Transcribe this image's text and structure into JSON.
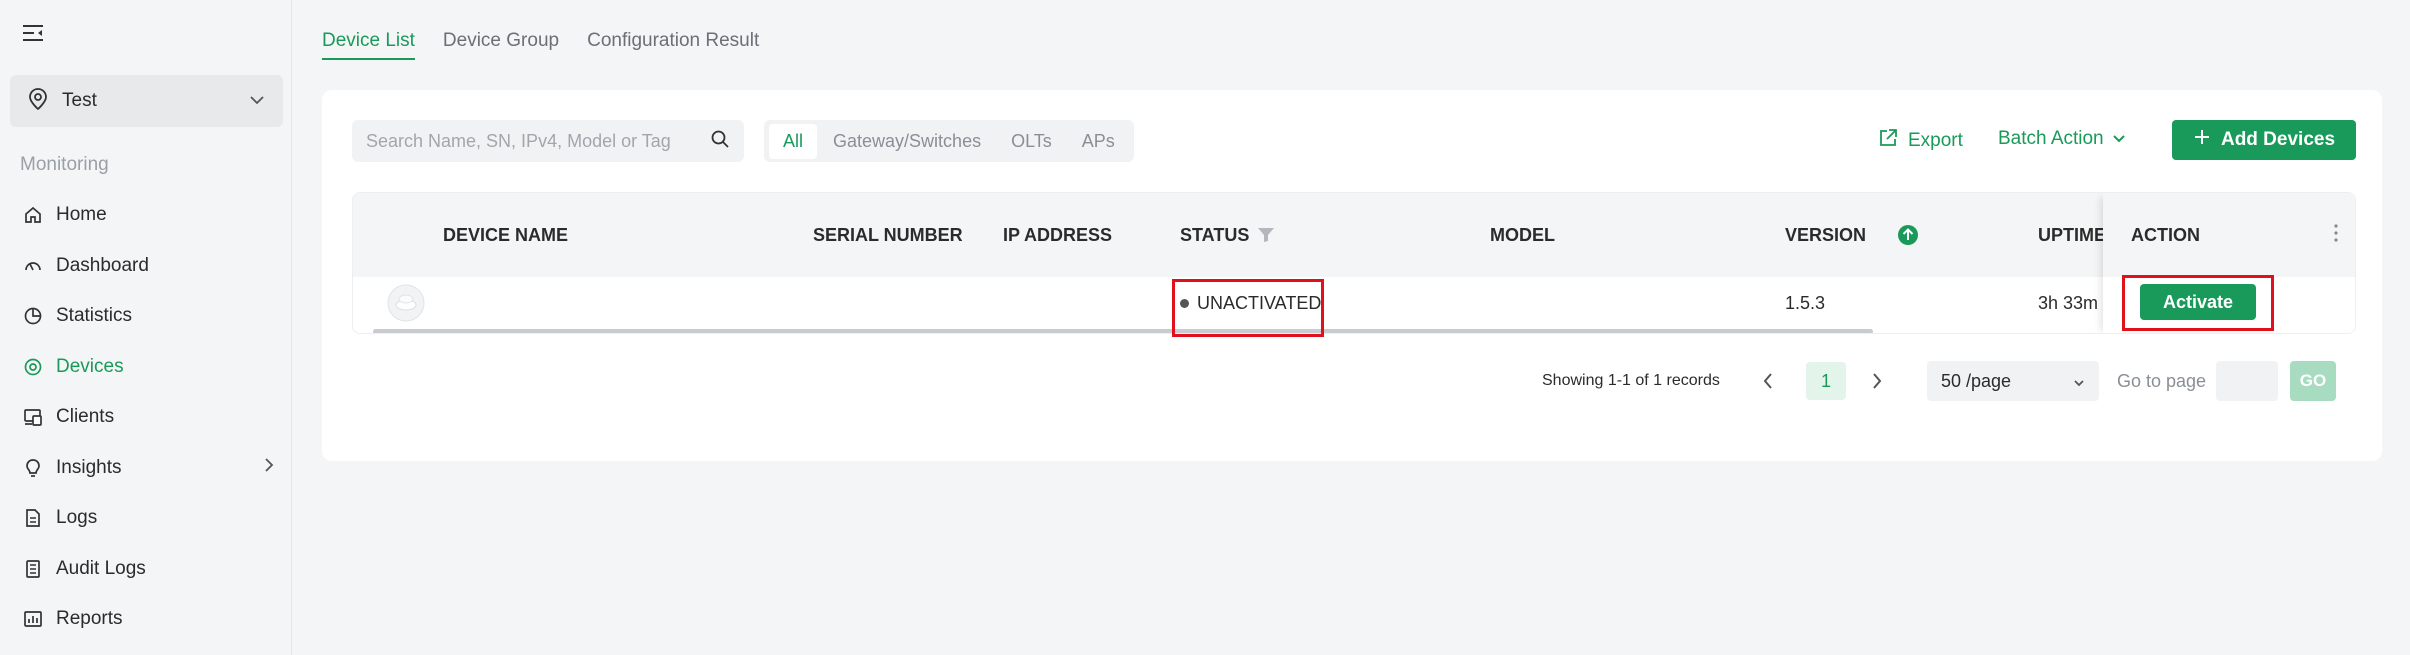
{
  "sidebar": {
    "site_name": "Test",
    "section_title": "Monitoring",
    "items": [
      {
        "label": "Home",
        "icon": "home-icon"
      },
      {
        "label": "Dashboard",
        "icon": "gauge-icon"
      },
      {
        "label": "Statistics",
        "icon": "pie-chart-icon"
      },
      {
        "label": "Devices",
        "icon": "target-icon",
        "active": true
      },
      {
        "label": "Clients",
        "icon": "clients-icon"
      },
      {
        "label": "Insights",
        "icon": "lightbulb-icon"
      },
      {
        "label": "Logs",
        "icon": "document-icon"
      },
      {
        "label": "Audit Logs",
        "icon": "list-document-icon"
      },
      {
        "label": "Reports",
        "icon": "report-chart-icon"
      }
    ]
  },
  "tabs": [
    "Device List",
    "Device Group",
    "Configuration Result"
  ],
  "toolbar": {
    "search_placeholder": "Search Name, SN, IPv4, Model or Tag",
    "filters": [
      "All",
      "Gateway/Switches",
      "OLTs",
      "APs"
    ],
    "export_label": "Export",
    "batch_label": "Batch Action",
    "add_label": "Add Devices"
  },
  "table": {
    "headers": {
      "device_name": "DEVICE NAME",
      "serial_number": "SERIAL NUMBER",
      "ip_address": "IP ADDRESS",
      "status": "STATUS",
      "model": "MODEL",
      "version": "VERSION",
      "uptime": "UPTIME",
      "action": "ACTION"
    },
    "rows": [
      {
        "device_name": "",
        "serial_number": "",
        "ip_address": "",
        "status": "UNACTIVATED",
        "model": "",
        "version": "1.5.3",
        "uptime": "3h 33m",
        "action": "Activate"
      }
    ]
  },
  "pagination": {
    "summary": "Showing 1-1 of 1 records",
    "current_page": "1",
    "page_size": "50 /page",
    "goto_label": "Go to page",
    "go_label": "GO"
  },
  "colors": {
    "accent": "#1a9a5a",
    "highlight": "#e0111b"
  }
}
